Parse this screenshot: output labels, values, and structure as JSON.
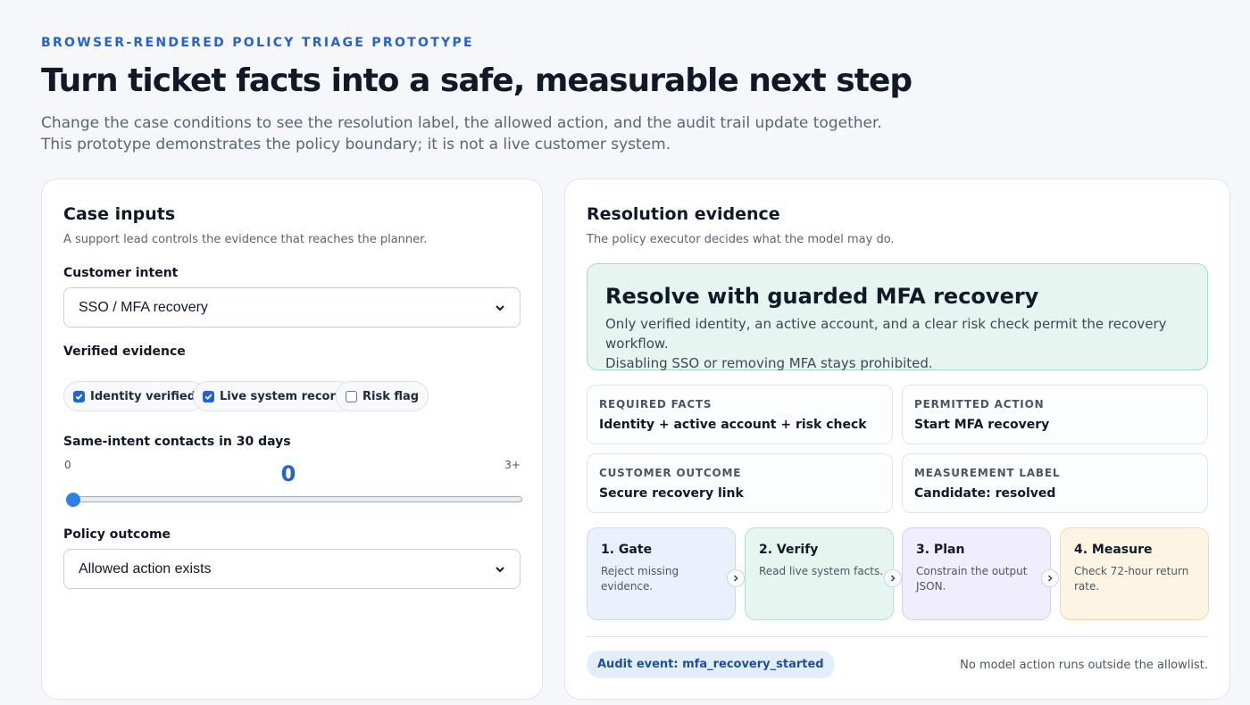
{
  "header": {
    "eyebrow": "BROWSER-RENDERED POLICY TRIAGE PROTOTYPE",
    "title": "Turn ticket facts into a safe, measurable next step",
    "lede_line1": "Change the case conditions to see the resolution label, the allowed action, and the audit trail update together.",
    "lede_line2": "This prototype demonstrates the policy boundary; it is not a live customer system."
  },
  "inputs": {
    "title": "Case inputs",
    "subtitle": "A support lead controls the evidence that reaches the planner.",
    "intent_label": "Customer intent",
    "intent_value": "SSO / MFA recovery",
    "evidence_label": "Verified evidence",
    "evidence": [
      {
        "label": "Identity verified",
        "checked": true
      },
      {
        "label": "Live system record",
        "checked": true
      },
      {
        "label": "Risk flag",
        "checked": false
      }
    ],
    "contacts_label": "Same-intent contacts in 30 days",
    "contacts_min": "0",
    "contacts_max": "3+",
    "contacts_value": "0",
    "contacts_level": 0,
    "outcome_label": "Policy outcome",
    "outcome_value": "Allowed action exists"
  },
  "evidence": {
    "title": "Resolution evidence",
    "subtitle": "The policy executor decides what the model may do.",
    "resolution_title": "Resolve with guarded MFA recovery",
    "resolution_line1": "Only verified identity, an active account, and a clear risk check permit the recovery workflow.",
    "resolution_line2": "Disabling SSO or removing MFA stays prohibited.",
    "facts": [
      {
        "label": "REQUIRED FACTS",
        "value": "Identity + active account + risk check"
      },
      {
        "label": "PERMITTED ACTION",
        "value": "Start MFA recovery"
      },
      {
        "label": "CUSTOMER OUTCOME",
        "value": "Secure recovery link"
      },
      {
        "label": "MEASUREMENT LABEL",
        "value": "Candidate: resolved"
      }
    ],
    "steps": [
      {
        "title": "1. Gate",
        "desc": "Reject missing evidence."
      },
      {
        "title": "2. Verify",
        "desc": "Read live system facts."
      },
      {
        "title": "3. Plan",
        "desc": "Constrain the output JSON."
      },
      {
        "title": "4. Measure",
        "desc": "Check 72-hour return rate."
      }
    ],
    "audit": "Audit event: mfa_recovery_started",
    "note": "No model action runs outside the allowlist."
  },
  "colors": {
    "accent": "#2563c9",
    "resolution_bg": "#e6f5ef",
    "gate_bg": "#eaf1fd",
    "verify_bg": "#e6f5ef",
    "plan_bg": "#f0edfc",
    "measure_bg": "#fef4e3"
  }
}
